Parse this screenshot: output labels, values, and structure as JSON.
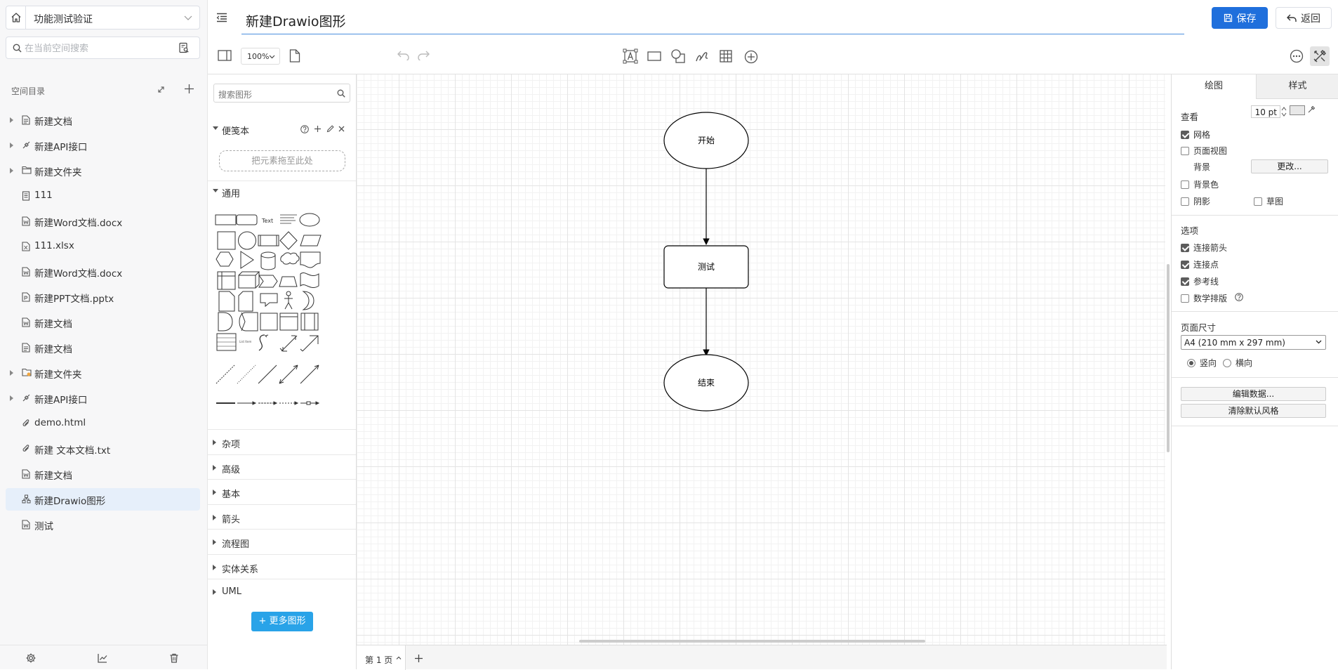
{
  "sidebar": {
    "space_name": "功能测试验证",
    "search_placeholder": "在当前空间搜索",
    "tree_title": "空间目录",
    "items": [
      {
        "label": "新建文档",
        "icon": "doc-icon",
        "expandable": true
      },
      {
        "label": "新建API接口",
        "icon": "api-icon",
        "expandable": true
      },
      {
        "label": "新建文件夹",
        "icon": "folder-icon",
        "expandable": true
      },
      {
        "label": "111",
        "icon": "file-icon",
        "expandable": false
      },
      {
        "label": "新建Word文档.docx",
        "icon": "word-icon",
        "expandable": false
      },
      {
        "label": "111.xlsx",
        "icon": "excel-icon",
        "expandable": false
      },
      {
        "label": "新建Word文档.docx",
        "icon": "word-icon",
        "expandable": false
      },
      {
        "label": "新建PPT文档.pptx",
        "icon": "ppt-icon",
        "expandable": false
      },
      {
        "label": "新建文档",
        "icon": "word-icon",
        "expandable": false
      },
      {
        "label": "新建文档",
        "icon": "doc-icon",
        "expandable": false
      },
      {
        "label": "新建文件夹",
        "icon": "shared-folder-icon",
        "expandable": true
      },
      {
        "label": "新建API接口",
        "icon": "api-icon",
        "expandable": true
      },
      {
        "label": "demo.html",
        "icon": "attachment-icon",
        "expandable": false
      },
      {
        "label": "新建 文本文档.txt",
        "icon": "attachment-icon",
        "expandable": false
      },
      {
        "label": "新建文档",
        "icon": "word-icon",
        "expandable": false
      },
      {
        "label": "新建Drawio图形",
        "icon": "drawio-icon",
        "expandable": false,
        "active": true
      },
      {
        "label": "测试",
        "icon": "word-icon",
        "expandable": false
      }
    ]
  },
  "header": {
    "title": "新建Drawio图形",
    "save_label": "保存",
    "back_label": "返回"
  },
  "toolbar": {
    "zoom": "100%"
  },
  "shapes_panel": {
    "search_placeholder": "搜索图形",
    "scratchpad_label": "便笺本",
    "scratchpad_drop": "把元素拖至此处",
    "general_label": "通用",
    "text_shape": "Text",
    "list_item_text": "List Item",
    "sections": [
      "杂项",
      "高级",
      "基本",
      "箭头",
      "流程图",
      "实体关系",
      "UML"
    ],
    "more_shapes": "+ 更多图形"
  },
  "diagram": {
    "nodes": [
      {
        "id": "start",
        "label": "开始",
        "shape": "ellipse"
      },
      {
        "id": "test",
        "label": "测试",
        "shape": "rounded-rect"
      },
      {
        "id": "end",
        "label": "结束",
        "shape": "ellipse"
      }
    ],
    "edges": [
      [
        "start",
        "test"
      ],
      [
        "test",
        "end"
      ]
    ]
  },
  "page_tabs": {
    "current": "第 1 页"
  },
  "format_panel": {
    "tab_diagram": "绘图",
    "tab_style": "样式",
    "view_title": "查看",
    "grid_label": "网格",
    "grid_checked": true,
    "grid_size": "10 pt",
    "page_view_label": "页面视图",
    "page_view_checked": false,
    "background_label": "背景",
    "change_label": "更改...",
    "background_color_label": "背景色",
    "background_color_checked": false,
    "shadow_label": "阴影",
    "shadow_checked": false,
    "sketch_label": "草图",
    "sketch_checked": false,
    "options_title": "选项",
    "connection_arrows_label": "连接箭头",
    "connection_arrows_checked": true,
    "connection_points_label": "连接点",
    "connection_points_checked": true,
    "guides_label": "参考线",
    "guides_checked": true,
    "math_label": "数学排版",
    "math_checked": false,
    "page_size_title": "页面尺寸",
    "page_size_value": "A4 (210 mm x 297 mm)",
    "portrait_label": "竖向",
    "landscape_label": "横向",
    "portrait_selected": true,
    "edit_data_label": "编辑数据...",
    "clear_default_style_label": "清除默认风格"
  },
  "colors": {
    "accent": "#1f6fdc",
    "active_item_bg": "#e6effa",
    "more_shapes_btn": "#29a3e8"
  }
}
